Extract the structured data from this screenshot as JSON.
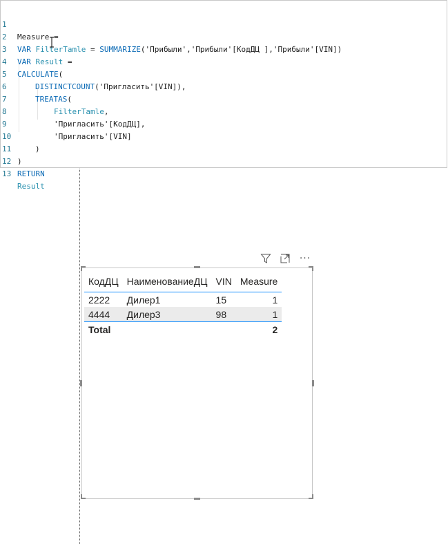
{
  "editor": {
    "lines": [
      {
        "n": "1",
        "text": "Measure ="
      },
      {
        "n": "2",
        "kw1": "VAR",
        "var": "FilterTamle",
        "eq": " = ",
        "fn": "SUMMARIZE",
        "rest": "('Прибыли','Прибыли'[КодДЦ ],'Прибыли'[VIN])"
      },
      {
        "n": "3",
        "kw1": "VAR",
        "var": "Result",
        "eq": " ="
      },
      {
        "n": "4",
        "fn": "CALCULATE",
        "rest": "("
      },
      {
        "n": "5",
        "fn": "DISTINCTCOUNT",
        "rest": "('Пригласить'[VIN]),"
      },
      {
        "n": "6",
        "fn": "TREATAS",
        "rest": "("
      },
      {
        "n": "7",
        "var": "FilterTamle",
        "rest": ","
      },
      {
        "n": "8",
        "rest": "'Пригласить'[КодДЦ],"
      },
      {
        "n": "9",
        "rest": "'Пригласить'[VIN]"
      },
      {
        "n": "10",
        "rest": ")"
      },
      {
        "n": "11",
        "rest": ")"
      },
      {
        "n": "12",
        "kw1": "RETURN"
      },
      {
        "n": "13",
        "var": "Result"
      }
    ]
  },
  "visual": {
    "header_icons": [
      "filter-icon",
      "focus-mode-icon",
      "more-options-icon"
    ],
    "more_glyph": "···",
    "columns": [
      "КодДЦ",
      "НаименованиеДЦ",
      "VIN",
      "Measure"
    ],
    "rows": [
      [
        "2222",
        "Дилер1",
        "15",
        "1"
      ],
      [
        "4444",
        "Дилер3",
        "98",
        "1"
      ]
    ],
    "total": {
      "label": "Total",
      "value": "2"
    }
  },
  "colors": {
    "accent": "#118dff",
    "keyword": "#0b6ab5",
    "variable": "#2b91af"
  }
}
